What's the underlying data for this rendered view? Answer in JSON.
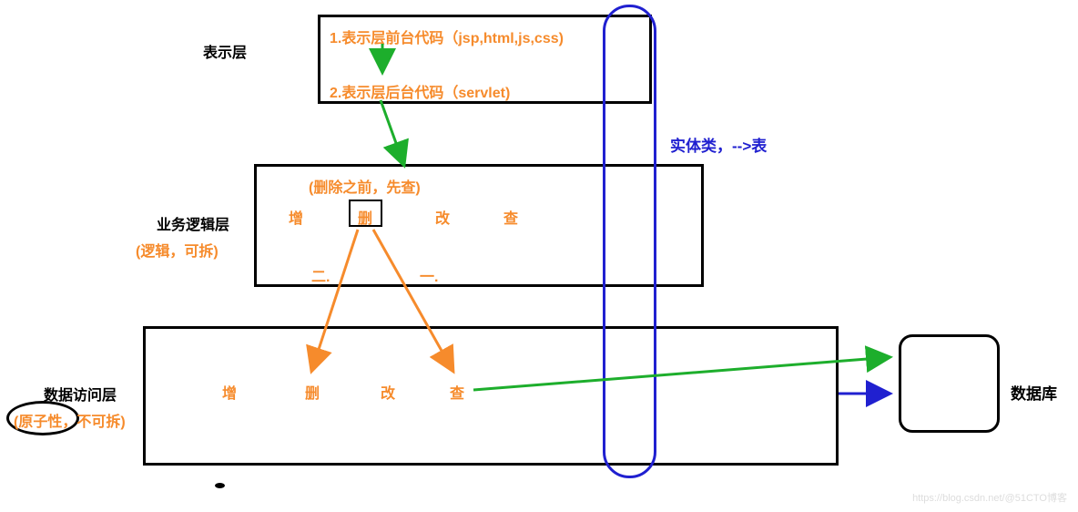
{
  "layers": {
    "presentation": {
      "title": "表示层",
      "line1": "1.表示层前台代码（jsp,html,js,css)",
      "line2": "2.表示层后台代码（servlet)"
    },
    "business": {
      "title": "业务逻辑层",
      "subtitle": "(逻辑，可拆)",
      "note": "(删除之前，先查)",
      "ops": {
        "c": "增",
        "d": "删",
        "u": "改",
        "r": "查"
      },
      "step1": "二.",
      "step2": "一."
    },
    "data_access": {
      "title": "数据访问层",
      "subtitle": "(原子性，不可拆)",
      "ops": {
        "c": "增",
        "d": "删",
        "u": "改",
        "r": "查"
      }
    }
  },
  "entity": {
    "label": "实体类，-->表"
  },
  "database": {
    "label": "数据库"
  },
  "watermark": "https://blog.csdn.net/@51CTO博客"
}
